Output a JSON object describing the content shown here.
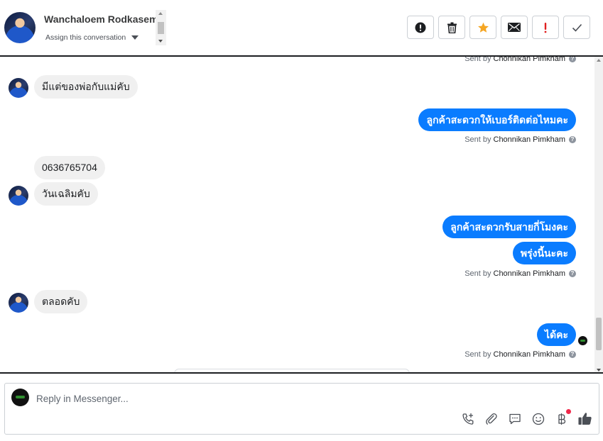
{
  "header": {
    "user_name": "Wanchaloem Rodkasem",
    "assign_label": "Assign this conversation",
    "actions": [
      {
        "name": "mark-spam-button",
        "icon": "alert-circle-icon"
      },
      {
        "name": "delete-button",
        "icon": "trash-icon"
      },
      {
        "name": "star-button",
        "icon": "star-icon",
        "color": "#f5a623"
      },
      {
        "name": "mark-unread-button",
        "icon": "envelope-icon"
      },
      {
        "name": "important-button",
        "icon": "exclamation-icon",
        "color": "#e02020"
      },
      {
        "name": "done-button",
        "icon": "checkmark-icon"
      }
    ]
  },
  "conversation": {
    "sent_by_prefix": "Sent by",
    "agent_name": "Chonnikan Pimkham",
    "messages": [
      {
        "from": "customer",
        "text": "มีแต่ของพ่อกับแม่คับ"
      },
      {
        "from": "page",
        "text": "ลูกค้าสะดวกให้เบอร์ติดต่อไหมคะ"
      },
      {
        "from": "customer",
        "text": "0636765704"
      },
      {
        "from": "customer",
        "text": "วันเฉลิมคับ"
      },
      {
        "from": "page",
        "text": "ลูกค้าสะดวกรับสายกี่โมงคะ"
      },
      {
        "from": "page",
        "text": "พรุ่งนี้นะคะ"
      },
      {
        "from": "customer",
        "text": "ตลอดคับ"
      },
      {
        "from": "page",
        "text": "ได้คะ"
      }
    ]
  },
  "composer": {
    "placeholder": "Reply in Messenger...",
    "tools": [
      "call-add-icon",
      "paperclip-icon",
      "saved-reply-icon",
      "emoji-icon",
      "baht-payment-icon",
      "thumbs-up-icon"
    ]
  },
  "colors": {
    "outgoing_bubble": "#0a7cff",
    "incoming_bubble": "#f0f0f0",
    "star": "#f5a623",
    "alert_red": "#e02020"
  }
}
